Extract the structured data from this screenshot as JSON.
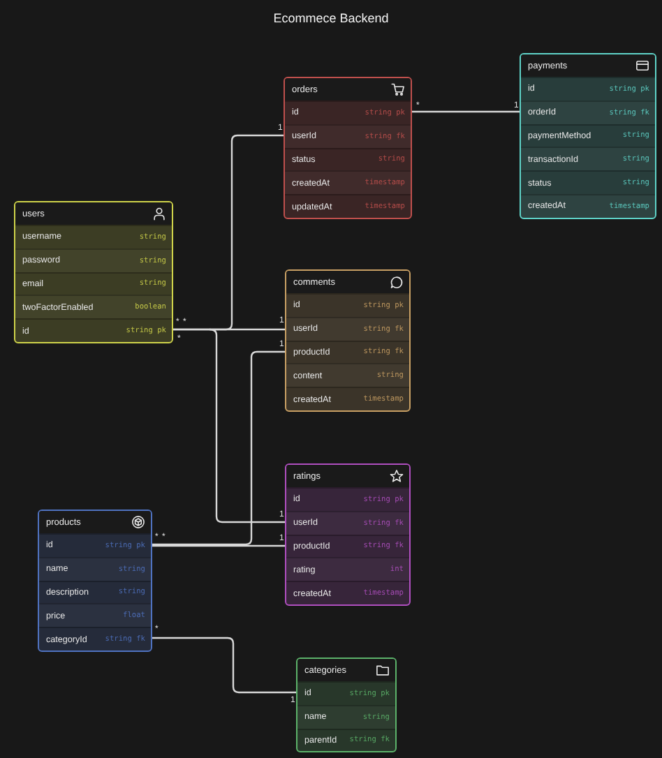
{
  "title": "Ecommece Backend",
  "tables": [
    {
      "name": "orders",
      "color": "#c0504d",
      "rows": [
        {
          "field": "id",
          "type": "string pk"
        },
        {
          "field": "userId",
          "type": "string fk"
        },
        {
          "field": "status",
          "type": "string"
        },
        {
          "field": "createdAt",
          "type": "timestamp"
        },
        {
          "field": "updatedAt",
          "type": "timestamp"
        }
      ]
    },
    {
      "name": "payments",
      "color": "#5fd3c8",
      "rows": [
        {
          "field": "id",
          "type": "string pk"
        },
        {
          "field": "orderId",
          "type": "string fk"
        },
        {
          "field": "paymentMethod",
          "type": "string"
        },
        {
          "field": "transactionId",
          "type": "string"
        },
        {
          "field": "status",
          "type": "string"
        },
        {
          "field": "createdAt",
          "type": "timestamp"
        }
      ]
    },
    {
      "name": "users",
      "color": "#cfd34a",
      "rows": [
        {
          "field": "username",
          "type": "string"
        },
        {
          "field": "password",
          "type": "string"
        },
        {
          "field": "email",
          "type": "string"
        },
        {
          "field": "twoFactorEnabled",
          "type": "boolean"
        },
        {
          "field": "id",
          "type": "string pk"
        }
      ]
    },
    {
      "name": "comments",
      "color": "#c9a064",
      "rows": [
        {
          "field": "id",
          "type": "string pk"
        },
        {
          "field": "userId",
          "type": "string fk"
        },
        {
          "field": "productId",
          "type": "string fk"
        },
        {
          "field": "content",
          "type": "string"
        },
        {
          "field": "createdAt",
          "type": "timestamp"
        }
      ]
    },
    {
      "name": "ratings",
      "color": "#b04fc0",
      "rows": [
        {
          "field": "id",
          "type": "string pk"
        },
        {
          "field": "userId",
          "type": "string fk"
        },
        {
          "field": "productId",
          "type": "string fk"
        },
        {
          "field": "rating",
          "type": "int"
        },
        {
          "field": "createdAt",
          "type": "timestamp"
        }
      ]
    },
    {
      "name": "products",
      "color": "#4f72c0",
      "rows": [
        {
          "field": "id",
          "type": "string pk"
        },
        {
          "field": "name",
          "type": "string"
        },
        {
          "field": "description",
          "type": "string"
        },
        {
          "field": "price",
          "type": "float"
        },
        {
          "field": "categoryId",
          "type": "string fk"
        }
      ]
    },
    {
      "name": "categories",
      "color": "#5cb36a",
      "rows": [
        {
          "field": "id",
          "type": "string pk"
        },
        {
          "field": "name",
          "type": "string"
        },
        {
          "field": "parentId",
          "type": "string fk"
        }
      ]
    }
  ],
  "relations": [
    {
      "from_label": "*",
      "to_label": "1"
    },
    {
      "from_label": "*",
      "to_label": "1"
    },
    {
      "from_label": "*",
      "to_label": "1"
    },
    {
      "from_label": "*",
      "to_label": "1"
    },
    {
      "from_label": "*",
      "to_label": "1"
    },
    {
      "from_label": "*",
      "to_label": "1"
    },
    {
      "from_label": "*",
      "to_label": "1"
    }
  ]
}
